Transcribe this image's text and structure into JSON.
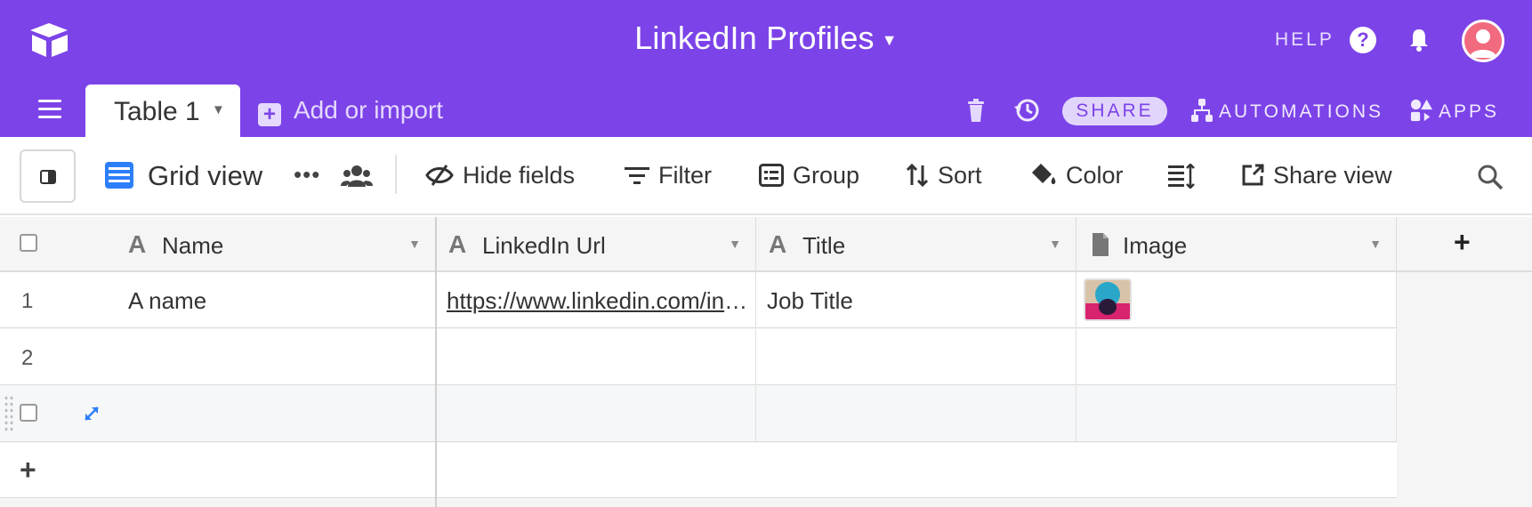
{
  "header": {
    "base_title": "LinkedIn Profiles",
    "help_label": "HELP",
    "brand_color": "#7c43e8"
  },
  "tabs": {
    "active_table": "Table 1",
    "add_import_label": "Add or import",
    "share_label": "SHARE",
    "automations_label": "AUTOMATIONS",
    "apps_label": "APPS"
  },
  "toolbar": {
    "view_name": "Grid view",
    "hide_fields": "Hide fields",
    "filter": "Filter",
    "group": "Group",
    "sort": "Sort",
    "color": "Color",
    "share_view": "Share view"
  },
  "grid": {
    "columns": [
      {
        "label": "Name",
        "type_icon": "text-field-icon"
      },
      {
        "label": "LinkedIn Url",
        "type_icon": "text-field-icon"
      },
      {
        "label": "Title",
        "type_icon": "text-field-icon"
      },
      {
        "label": "Image",
        "type_icon": "attachment-field-icon"
      }
    ],
    "rows": [
      {
        "num": "1",
        "name": "A name",
        "url": "https://www.linkedin.com/in/...",
        "title": "Job Title",
        "has_image": true
      },
      {
        "num": "2",
        "name": "",
        "url": "",
        "title": "",
        "has_image": false
      }
    ],
    "add_field_label": "+",
    "add_row_label": "+"
  }
}
